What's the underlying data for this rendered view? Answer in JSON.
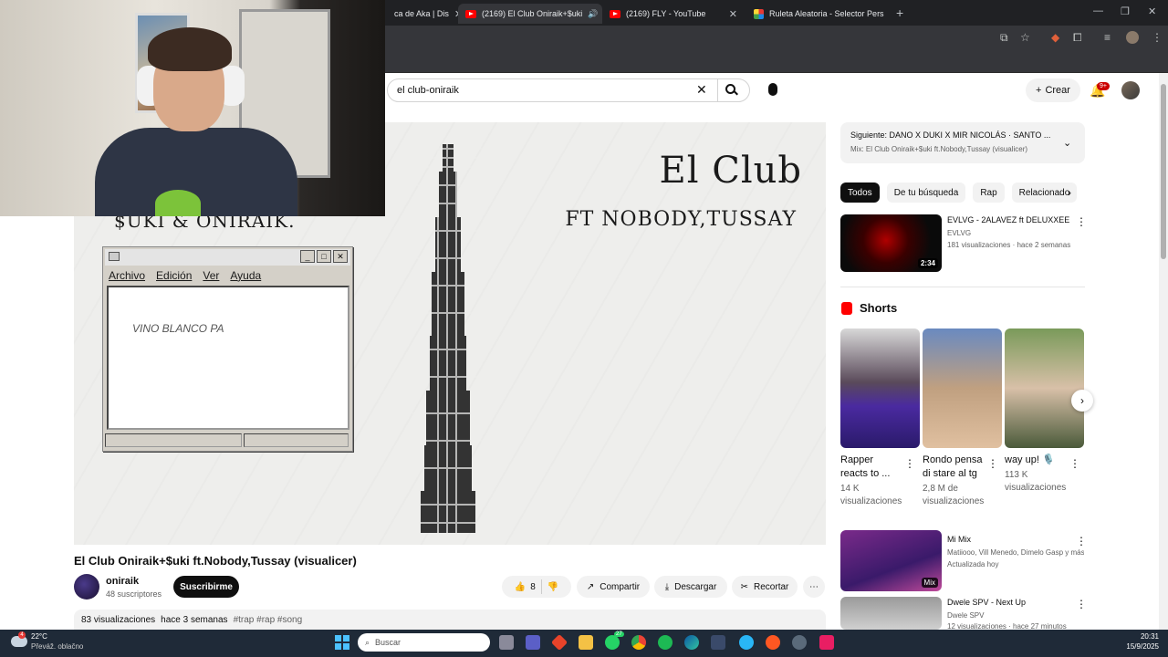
{
  "browser": {
    "tabs": [
      {
        "label": "ca de Aka | Dis",
        "active": false
      },
      {
        "label": "(2169) El Club Oniraik+$uki",
        "active": true
      },
      {
        "label": "(2169) FLY - YouTube",
        "active": false
      },
      {
        "label": "Ruleta Aleatoria - Selector Pers",
        "active": false
      }
    ],
    "new_tab_icon": "plus-icon"
  },
  "youtube": {
    "search_value": "el club-oniraik",
    "create_label": "Crear",
    "notifications_badge": "9+",
    "video": {
      "on_screen_title": "El Club",
      "on_screen_subtitle": "FT NOBODY,TUSSAY",
      "on_screen_artists": "$UKI & ONIRAIK.",
      "notepad": {
        "menu": [
          "Archivo",
          "Edición",
          "Ver",
          "Ayuda"
        ],
        "content": "VINO BLANCO PA"
      }
    },
    "title": "El Club Oniraik+$uki ft.Nobody,Tussay (visualicer)",
    "channel": {
      "name": "oniraik",
      "subscribers": "48 suscriptores"
    },
    "subscribe_label": "Suscribirme",
    "actions": {
      "likes": "8",
      "share": "Compartir",
      "download": "Descargar",
      "clip": "Recortar"
    },
    "description": {
      "views": "83 visualizaciones",
      "date": "hace 3 semanas",
      "tags": "#trap #rap #song"
    },
    "sidebar": {
      "mix_next": "Siguiente: DANO X DUKI X MIR NICOLÁS · SANTO ...",
      "mix_sub": "Mix: El Club Oniraik+$uki ft.Nobody,Tussay (visualicer)",
      "chips": [
        "Todos",
        "De tu búsqueda",
        "Rap",
        "Relacionado"
      ],
      "rec1": {
        "title": "EVLVG - 2ALAVEZ ft DELUXXEE",
        "channel": "EVLVG",
        "meta": "181 visualizaciones · hace 2 semanas",
        "duration": "2:34"
      },
      "shorts_heading": "Shorts",
      "shorts": [
        {
          "title": "Rapper reacts to ...",
          "views": "14 K",
          "views_label": "visualizaciones"
        },
        {
          "title": "Rondo pensa di stare al tg",
          "views": "2,8 M de",
          "views_label": "visualizaciones"
        },
        {
          "title": "way up! 🎙️",
          "views": "113 K",
          "views_label": "visualizaciones"
        }
      ],
      "rec2": {
        "title": "Mi Mix",
        "channel": "Matiiooo, Vill Menedo, Dimelo Gasp y más",
        "meta": "Actualizada hoy",
        "badge": "Mix"
      },
      "rec3": {
        "title": "Dwele SPV - Next Up",
        "channel": "Dwele SPV",
        "meta": "12 visualizaciones · hace 27 minutos"
      }
    }
  },
  "taskbar": {
    "weather_temp": "22°C",
    "weather_desc": "Převáž. oblačno",
    "weather_badge": "4",
    "search_placeholder": "Buscar",
    "whatsapp_badge": "27",
    "time": "20:31",
    "date": "15/9/2025"
  }
}
